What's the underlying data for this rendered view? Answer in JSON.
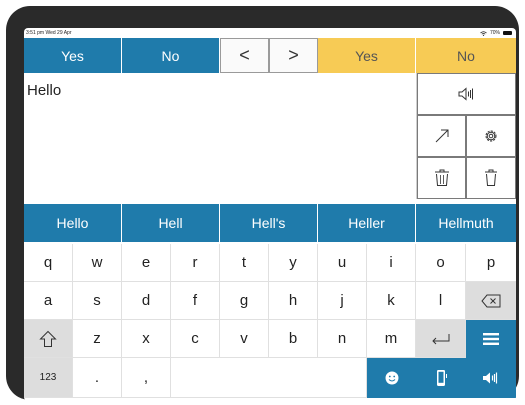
{
  "status": {
    "time": "3:51 pm",
    "date": "Wed 29 Apr",
    "battery": "70%"
  },
  "quick": {
    "yes1": "Yes",
    "no1": "No",
    "back": "<",
    "forward": ">",
    "yes2": "Yes",
    "no2": "No"
  },
  "message": {
    "text": "Hello"
  },
  "suggestions": [
    "Hello",
    "Hell",
    "Hell's",
    "Heller",
    "Hellmuth"
  ],
  "keys": {
    "row1": [
      "q",
      "w",
      "e",
      "r",
      "t",
      "y",
      "u",
      "i",
      "o",
      "p"
    ],
    "row2": [
      "a",
      "s",
      "d",
      "f",
      "g",
      "h",
      "j",
      "k",
      "l"
    ],
    "row3": [
      "z",
      "x",
      "c",
      "v",
      "b",
      "n",
      "m"
    ],
    "num": "123",
    "period": ".",
    "comma": ","
  },
  "colors": {
    "blue": "#1f7bab",
    "yellow": "#f7cb55",
    "key_gray": "#dddddd",
    "text_bg": "#ffffff"
  },
  "icons": {
    "speak": "speaker-icon",
    "share": "arrow-up-right-icon",
    "settings": "gear-icon",
    "clear_all": "trash-double-icon",
    "clear": "trash-icon",
    "backspace": "backspace-icon",
    "shift": "shift-arrow-icon",
    "enter": "return-icon",
    "menu": "menu-icon",
    "emoji": "smiley-icon",
    "phone": "phone-icon",
    "speak_small": "speaker-icon"
  }
}
